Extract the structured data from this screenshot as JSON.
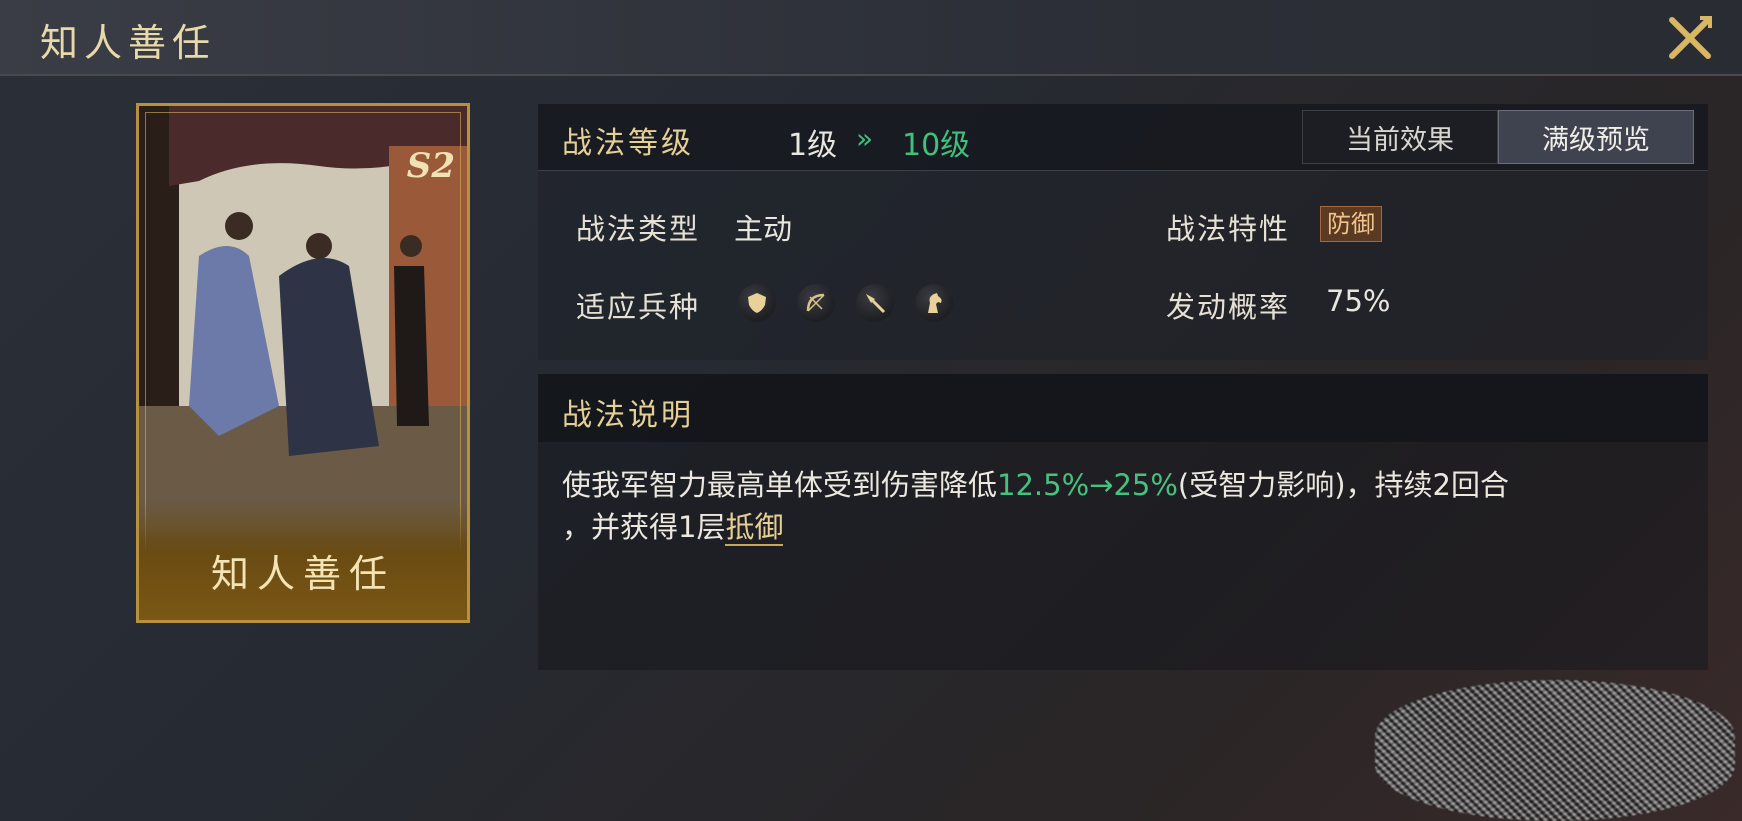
{
  "window": {
    "title": "知人善任"
  },
  "card": {
    "name": "知人善任",
    "season": "S2"
  },
  "level": {
    "label": "战法等级",
    "from": "1级",
    "to": "10级"
  },
  "tabs": [
    {
      "label": "当前效果",
      "active": false
    },
    {
      "label": "满级预览",
      "active": true
    }
  ],
  "attributes": {
    "type_label": "战法类型",
    "type_value": "主动",
    "trait_label": "战法特性",
    "trait_value": "防御",
    "units_label": "适应兵种",
    "units": [
      "shield-icon",
      "bow-icon",
      "spear-icon",
      "horse-icon"
    ],
    "rate_label": "发动概率",
    "rate_value": "75%"
  },
  "description": {
    "title": "战法说明",
    "part1": "使我军智力最高单体受到伤害降低",
    "highlight": "12.5%→25%",
    "part2": "(受智力影响)，持续2回合",
    "part3": "，并获得1层",
    "keyword": "抵御"
  },
  "colors": {
    "gold": "#e6cf95",
    "green": "#46c27e",
    "card_border": "#b8913f"
  }
}
